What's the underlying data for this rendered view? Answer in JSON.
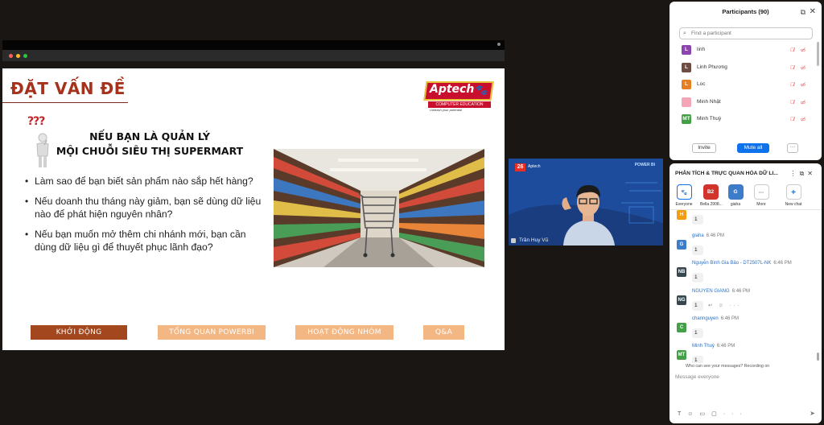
{
  "slide": {
    "title": "ĐẶT VẤN ĐỀ",
    "logo": {
      "brand": "Aptech",
      "sub": "COMPUTER EDUCATION",
      "tagline": "Unleash your potential"
    },
    "question_marks": "???",
    "heading_line1": "NẾU BẠN LÀ QUẢN LÝ",
    "heading_line2": "MỘI CHUỖI SIÊU THỊ SUPERMART",
    "bullets": [
      "Làm sao để bạn biết sản phẩm nào sắp hết hàng?",
      "Nếu doanh thu tháng này giảm, bạn sẽ dùng dữ liệu nào để phát hiện nguyên nhân?",
      "Nếu bạn muốn mở thêm chi nhánh mới, bạn cần dùng dữ liệu gì để thuyết phục lãnh đạo?"
    ],
    "footer_buttons": [
      "KHỞI ĐỘNG",
      "TỔNG QUAN POWERBI",
      "HOẠT ĐỘNG NHÓM",
      "Q&A"
    ]
  },
  "video": {
    "name": "Trần Huy Vũ",
    "badge": "26",
    "brand": "Aptech",
    "banner": "POWER BI"
  },
  "participants": {
    "title": "Participants (90)",
    "search_placeholder": "Find a participant",
    "list": [
      {
        "initial": "L",
        "name": "linh",
        "color": "#8e44ad"
      },
      {
        "initial": "L",
        "name": "Linh Phương",
        "color": "#6d4c41"
      },
      {
        "initial": "L",
        "name": "Loc",
        "color": "#e67e22"
      },
      {
        "initial": "",
        "name": "Minh Nhật",
        "color": "#f4a6b8"
      },
      {
        "initial": "MT",
        "name": "Minh Thuỳ",
        "color": "#43a047"
      }
    ],
    "invite_label": "Invite",
    "mute_all_label": "Mute all",
    "more_label": "···"
  },
  "chat": {
    "title": "PHÂN TÍCH & TRỰC QUAN HÓA DỮ LI...",
    "recipients": [
      {
        "icon": "🐾",
        "label": "Everyone"
      },
      {
        "icon": "B2",
        "label": "Bella 2908..."
      },
      {
        "icon": "G",
        "label": "giaha"
      },
      {
        "icon": "···",
        "label": "More"
      },
      {
        "icon": "+",
        "label": "New chat"
      }
    ],
    "messages": [
      {
        "initial": "H",
        "name": "",
        "time": "",
        "text": "1",
        "color": "#f39c12"
      },
      {
        "initial": "G",
        "name": "giaha",
        "time": "6:46 PM",
        "text": "1",
        "color": "#3d7cc9"
      },
      {
        "initial": "NB",
        "name": "Nguyễn Bình Gia Bảo - DT2507L-NK",
        "time": "6:46 PM",
        "text": "1",
        "color": "#37474f"
      },
      {
        "initial": "NG",
        "name": "NGUYEN GIANG",
        "time": "6:46 PM",
        "text": "1",
        "color": "#37474f"
      },
      {
        "initial": "C",
        "name": "channguyen",
        "time": "6:46 PM",
        "text": "1",
        "color": "#43a047"
      },
      {
        "initial": "MT",
        "name": "Minh Thuỳ",
        "time": "6:46 PM",
        "text": "1",
        "color": "#43a047"
      }
    ],
    "notice": "Who can see your messages? Recording on",
    "input_placeholder": "Message everyone"
  },
  "colors": {
    "slide_title": "#a6321c",
    "footer_active": "#a3471f",
    "footer_inactive": "#f3b784",
    "zoom_blue": "#0e72ed"
  }
}
